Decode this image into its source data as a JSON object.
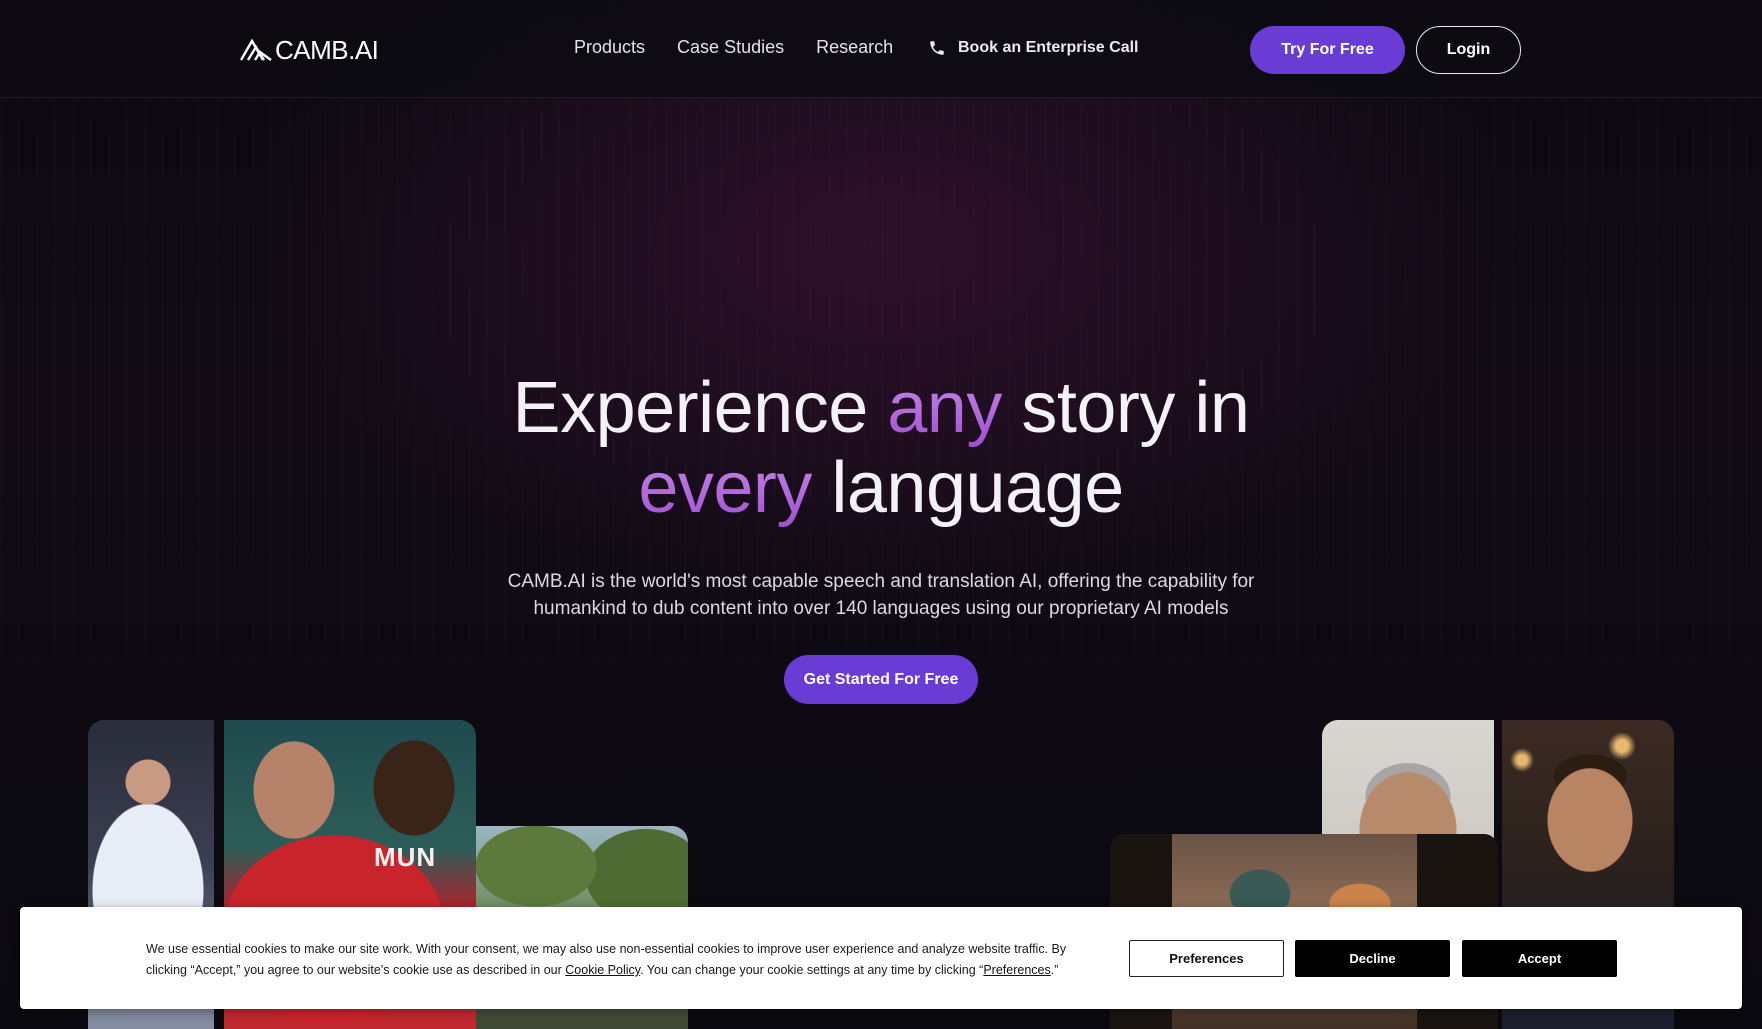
{
  "nav": {
    "logo_text": "CAMB.AI",
    "links": [
      "Products",
      "Case Studies",
      "Research"
    ],
    "enterprise_label": "Book an Enterprise Call",
    "try_label": "Try For Free",
    "login_label": "Login",
    "colors": {
      "accent": "#6a3cd6"
    }
  },
  "hero": {
    "title_part1": "Experience ",
    "title_highlight1": "any",
    "title_part2": " story in",
    "title_highlight2": "every",
    "title_part3": " language",
    "subtitle_line1": "CAMB.AI is the world's most capable speech and translation AI, offering the capability for",
    "subtitle_line2": "humankind to dub content into over 140 languages using our proprietary AI models",
    "cta_label": "Get Started For Free",
    "highlight_color": "#b26ade"
  },
  "collage": {
    "football_jersey_text": "MUN"
  },
  "cookie": {
    "text_part1": "We use essential cookies to make our site work. With your consent, we may also use non-essential cookies to improve user experience and analyze website traffic. By clicking “Accept,” you agree to our website's cookie use as described in our ",
    "policy_link": "Cookie Policy",
    "text_part2": ". You can change your cookie settings at any time by clicking “",
    "preferences_link": "Preferences",
    "text_part3": ".”",
    "preferences_label": "Preferences",
    "decline_label": "Decline",
    "accept_label": "Accept"
  },
  "icons": {
    "logo": "camb-logo-icon",
    "phone": "phone-icon"
  }
}
